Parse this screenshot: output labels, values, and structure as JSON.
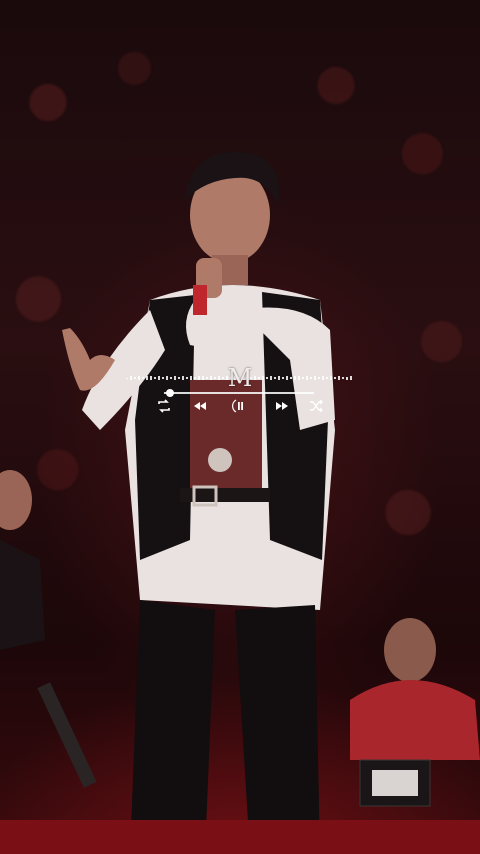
{
  "player": {
    "logo_letter": "M",
    "progress": 0.04,
    "controls": [
      {
        "name": "repeat-icon"
      },
      {
        "name": "previous-icon"
      },
      {
        "name": "pause-icon"
      },
      {
        "name": "next-icon"
      },
      {
        "name": "shuffle-icon"
      }
    ]
  },
  "colors": {
    "overlay_white": "#ffffff",
    "background_red": "#3a0a0d"
  }
}
